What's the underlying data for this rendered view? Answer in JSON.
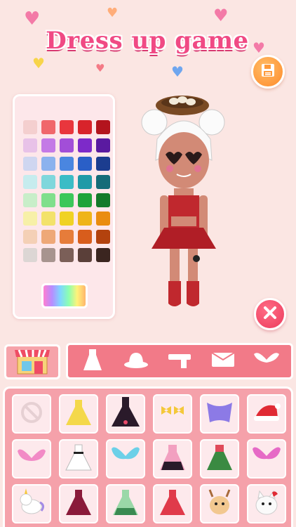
{
  "app": {
    "title": "Dress up game"
  },
  "colors": {
    "accent_pink": "#f04a84",
    "save_orange": "#ff8a2a",
    "delete_red": "#ec3a5c",
    "category_bar": "#f27a88",
    "items_panel": "#f5a1aa",
    "palette_panel": "#fde7ea"
  },
  "palette": {
    "swatches": [
      "#f4cfcf",
      "#f0676b",
      "#e9363d",
      "#d8232b",
      "#b3141d",
      "#e8c2e8",
      "#c47ae6",
      "#a24ed8",
      "#7d2ac9",
      "#5a1aa0",
      "#cfd6f0",
      "#8bb2ee",
      "#4a86e0",
      "#2a5fc7",
      "#1c3d8f",
      "#c6ecee",
      "#7fd7dc",
      "#3bbcc6",
      "#1f9aa7",
      "#156c78",
      "#c8eec9",
      "#80df8c",
      "#3cc75a",
      "#1fa33a",
      "#137a2a",
      "#f7f0a8",
      "#f3e26b",
      "#f0d224",
      "#efb41a",
      "#ea8c10",
      "#f4d0b6",
      "#eea878",
      "#e67c3a",
      "#d85d1c",
      "#b3420e",
      "#dcd6d4",
      "#a7948f",
      "#7b5f58",
      "#5a3f39",
      "#3b2520"
    ],
    "rainbow_icon": "rainbow-swatch-icon"
  },
  "toolbar": {
    "save_icon": "save-floppy-icon",
    "delete_icon": "close-x-icon",
    "shop_icon": "shop-storefront-icon"
  },
  "categories": [
    {
      "icon": "dress-icon"
    },
    {
      "icon": "hat-icon"
    },
    {
      "icon": "scarf-icon"
    },
    {
      "icon": "bag-icon"
    },
    {
      "icon": "wings-icon"
    }
  ],
  "items": [
    {
      "icon": "none-prohibited-icon"
    },
    {
      "icon": "yellow-dress-icon"
    },
    {
      "icon": "black-gown-icon"
    },
    {
      "icon": "yellow-bows-icon"
    },
    {
      "icon": "purple-cape-icon"
    },
    {
      "icon": "santa-hat-icon"
    },
    {
      "icon": "pink-wings-icon"
    },
    {
      "icon": "white-dress-icon"
    },
    {
      "icon": "blue-wings-icon"
    },
    {
      "icon": "pink-black-dress-icon"
    },
    {
      "icon": "green-dress-icon"
    },
    {
      "icon": "magenta-wings-icon"
    },
    {
      "icon": "unicorn-icon"
    },
    {
      "icon": "burgundy-dress-icon"
    },
    {
      "icon": "mint-dress-icon"
    },
    {
      "icon": "red-dress-icon"
    },
    {
      "icon": "deer-pet-icon"
    },
    {
      "icon": "cat-pet-icon"
    }
  ]
}
